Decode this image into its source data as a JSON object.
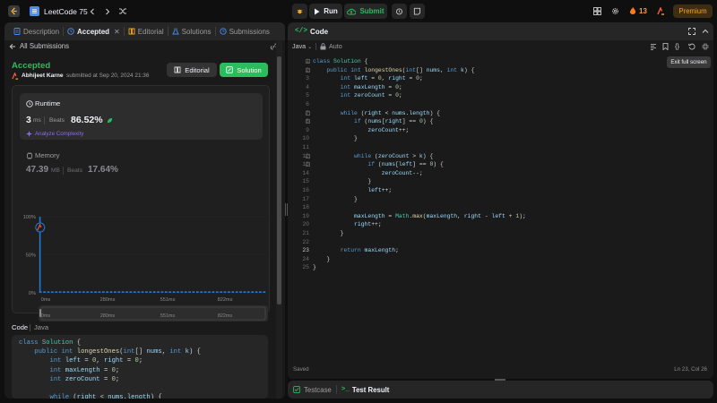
{
  "app": {
    "title": "LeetCode 75"
  },
  "toolbar": {
    "run": "Run",
    "submit": "Submit",
    "streak": "13",
    "premium": "Premium"
  },
  "left_tabs": [
    {
      "label": "Description"
    },
    {
      "label": "Accepted"
    },
    {
      "label": "Editorial"
    },
    {
      "label": "Solutions"
    },
    {
      "label": "Submissions"
    }
  ],
  "submission": {
    "back_label": "All Submissions",
    "status": "Accepted",
    "user": "Abhijeet Karne",
    "submitted_text": "submitted at Sep 20, 2024 21:36",
    "editorial_button": "Editorial",
    "solution_button": "Solution",
    "runtime_label": "Runtime",
    "runtime_value": "3",
    "runtime_unit": "ms",
    "beats_label": "Beats",
    "runtime_beats": "86.52%",
    "analyze_label": "Analyze Complexity",
    "memory_label": "Memory",
    "memory_value": "47.39",
    "memory_unit": "MB",
    "memory_beats": "17.64%"
  },
  "chart_data": {
    "type": "bar",
    "y_ticks": [
      "100%",
      "50%",
      "0%"
    ],
    "x_ticks": [
      "0ms",
      "280ms",
      "551ms",
      "822ms"
    ],
    "ylim": [
      0,
      100
    ],
    "highlight_value": 100,
    "baseline_bar_count": 58,
    "baseline_value": 2,
    "bar_color": "#2577d6"
  },
  "code_section": {
    "label": "Code",
    "lang": "Java"
  },
  "editor": {
    "header": "Code",
    "language": "Java",
    "mode": "Auto",
    "tooltip": "Exit full screen",
    "status_left": "Saved",
    "status_right": "Ln 23, Col 26"
  },
  "bottom": {
    "testcase": "Testcase",
    "result": "Test Result"
  },
  "code_lines": [
    "class Solution {",
    "    public int longestOnes(int[] nums, int k) {",
    "        int left = 0, right = 0;",
    "        int maxLength = 0;",
    "        int zeroCount = 0;",
    "",
    "        while (right < nums.length) {",
    "            if (nums[right] == 0) {",
    "                zeroCount++;",
    "            }",
    "",
    "            while (zeroCount > k) {",
    "                if (nums[left] == 0) {",
    "                    zeroCount--;",
    "                }",
    "                left++;",
    "            }",
    "",
    "            maxLength = Math.max(maxLength, right - left + 1);",
    "            right++;",
    "        }",
    "",
    "        return maxLength;",
    "    }",
    "}"
  ],
  "left_code_lines": [
    "class Solution {",
    "    public int longestOnes(int[] nums, int k) {",
    "        int left = 0, right = 0;",
    "        int maxLength = 0;",
    "        int zeroCount = 0;",
    "",
    "        while (right < nums.length) {"
  ]
}
